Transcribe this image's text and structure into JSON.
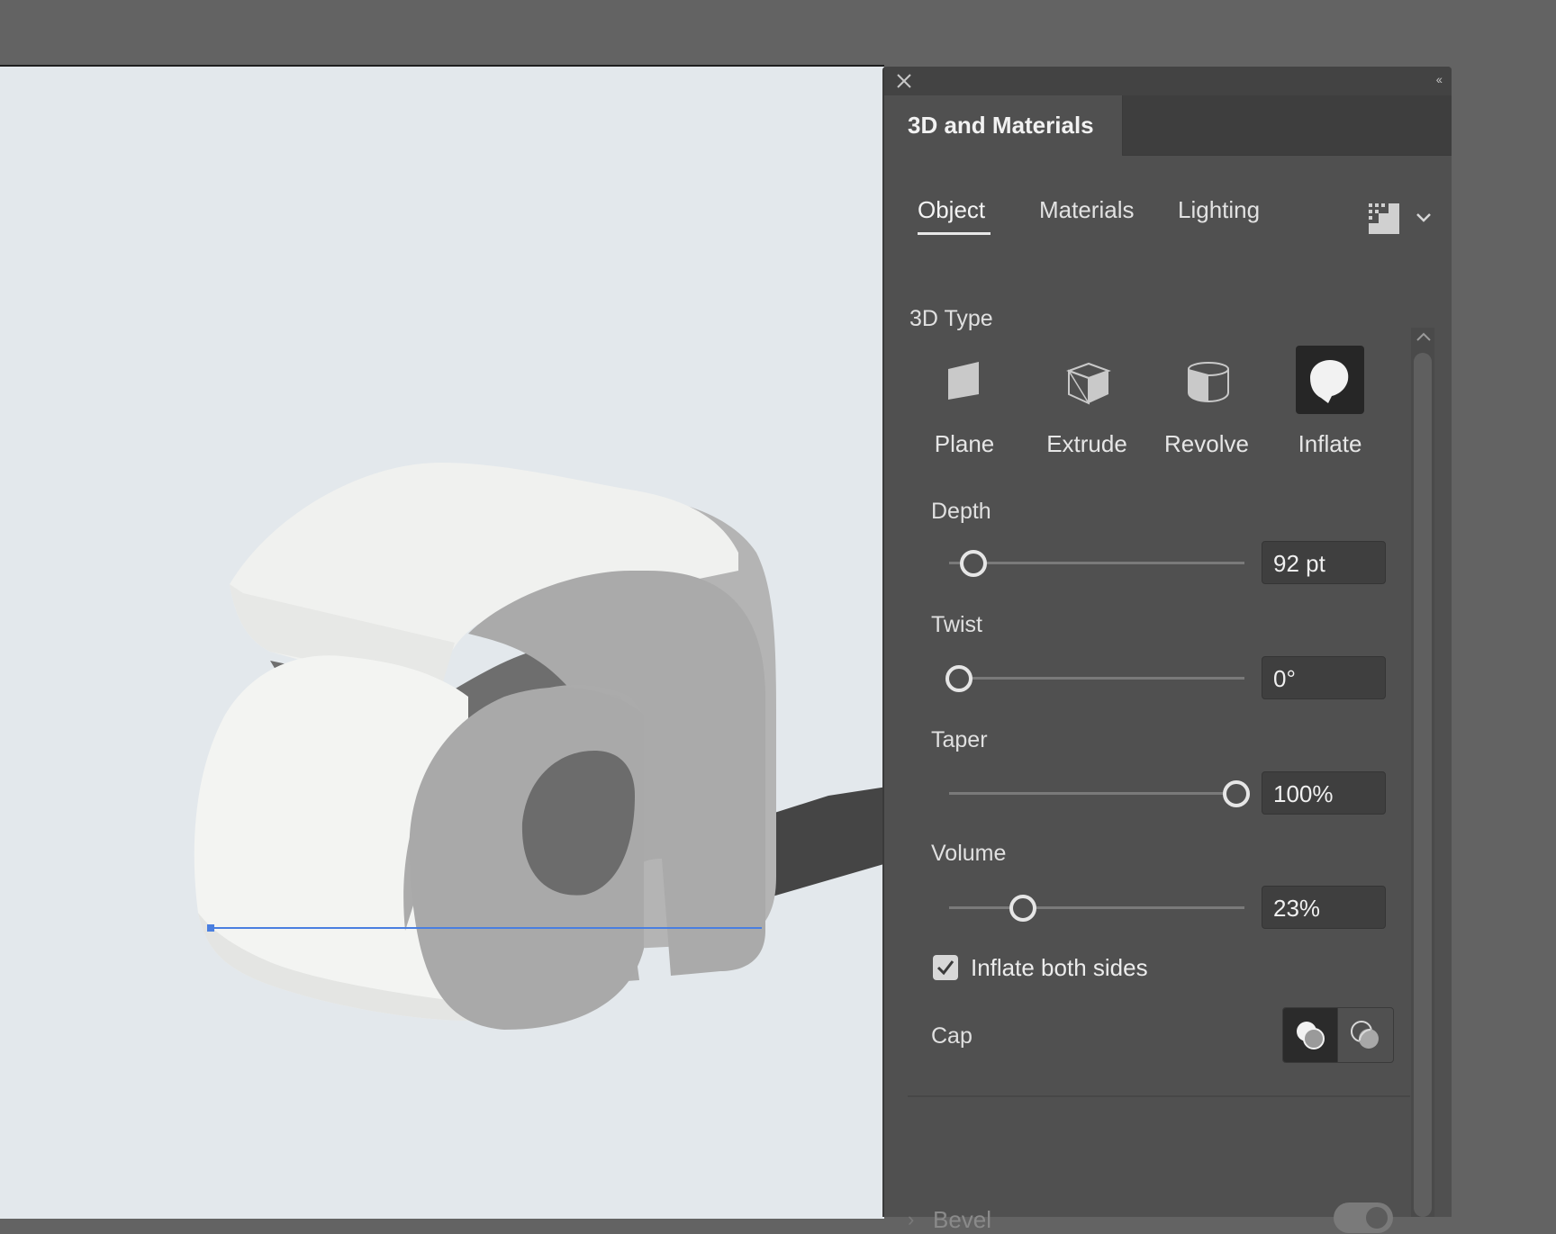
{
  "panel": {
    "title": "3D and Materials",
    "tabs": [
      {
        "label": "Object",
        "active": true
      },
      {
        "label": "Materials",
        "active": false
      },
      {
        "label": "Lighting",
        "active": false
      }
    ],
    "icons": {
      "close": "close-icon",
      "collapse": "collapse-double-chevron-icon",
      "quality": "render-quality-icon",
      "menu": "chevron-down-icon"
    }
  },
  "object": {
    "type_label": "3D Type",
    "types": [
      {
        "label": "Plane",
        "icon": "plane-icon",
        "selected": false
      },
      {
        "label": "Extrude",
        "icon": "extrude-icon",
        "selected": false
      },
      {
        "label": "Revolve",
        "icon": "revolve-icon",
        "selected": false
      },
      {
        "label": "Inflate",
        "icon": "inflate-icon",
        "selected": true
      }
    ],
    "depth": {
      "label": "Depth",
      "value": "92 pt",
      "level": 0.08
    },
    "twist": {
      "label": "Twist",
      "value": "0°",
      "level": 0.0
    },
    "taper": {
      "label": "Taper",
      "value": "100%",
      "level": 1.0
    },
    "volume": {
      "label": "Volume",
      "value": "23%",
      "level": 0.25
    },
    "inflate_both_sides": {
      "label": "Inflate both sides",
      "checked": true
    },
    "cap": {
      "label": "Cap",
      "selected": "cap-on",
      "options": [
        "cap-on-icon",
        "cap-off-icon"
      ]
    },
    "bevel": {
      "label": "Bevel",
      "enabled": false
    }
  },
  "colors": {
    "panel_bg": "#505050",
    "canvas_bg": "#e3e8ec",
    "selection_line": "#4a7fe0"
  }
}
